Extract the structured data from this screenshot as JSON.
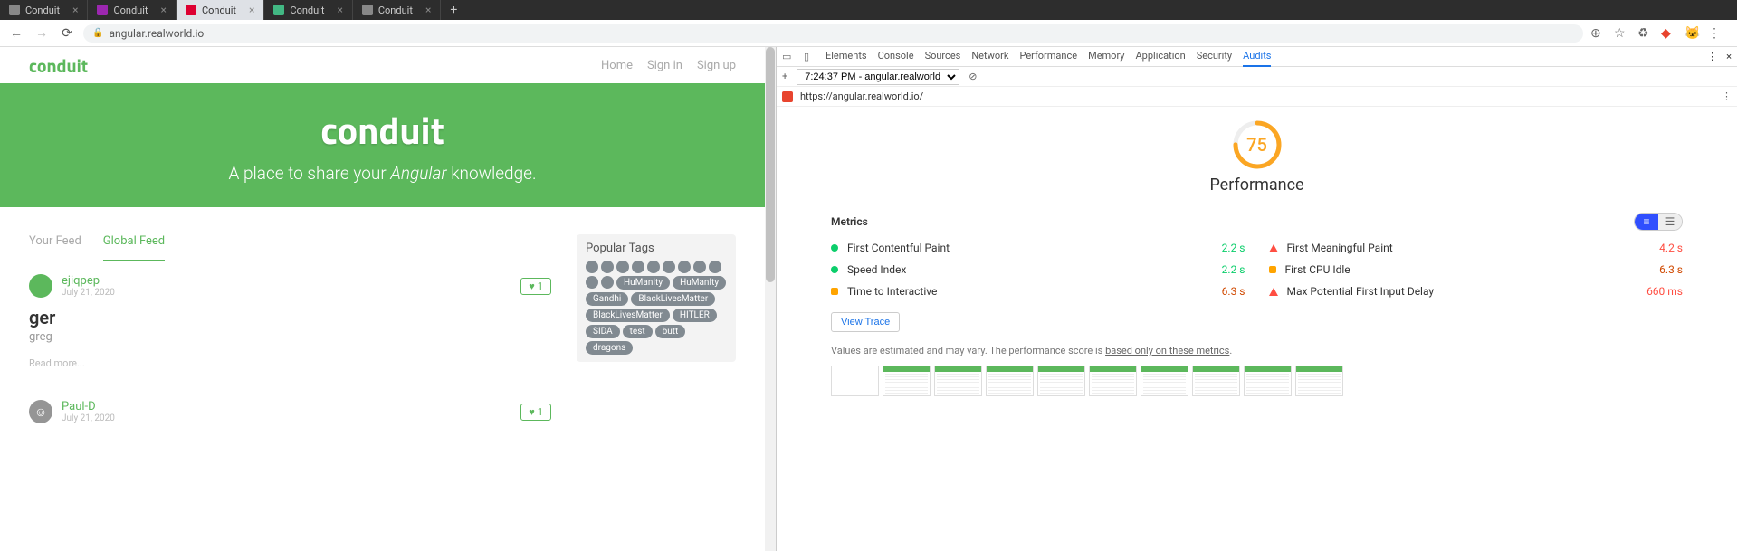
{
  "browser": {
    "tabs": [
      {
        "label": "Conduit",
        "favicon": "#888"
      },
      {
        "label": "Conduit",
        "favicon": "#9c27b0"
      },
      {
        "label": "Conduit",
        "favicon": "#dd0031",
        "active": true
      },
      {
        "label": "Conduit",
        "favicon": "#42b883"
      },
      {
        "label": "Conduit",
        "favicon": "#888"
      }
    ],
    "url": "angular.realworld.io"
  },
  "app": {
    "brand": "conduit",
    "nav": {
      "home": "Home",
      "signin": "Sign in",
      "signup": "Sign up"
    },
    "hero": {
      "title": "conduit",
      "subtitle_pre": "A place to share your ",
      "subtitle_em": "Angular",
      "subtitle_post": " knowledge."
    },
    "feed_tabs": {
      "your": "Your Feed",
      "global": "Global Feed"
    },
    "articles": [
      {
        "author": "ejiqpep",
        "date": "July 21, 2020",
        "likes": "1",
        "title": "ger",
        "desc": "greg",
        "read_more": "Read more...",
        "avatar": "green"
      },
      {
        "author": "Paul-D",
        "date": "July 21, 2020",
        "likes": "1",
        "title": "",
        "desc": "",
        "read_more": "",
        "avatar": "grey"
      }
    ],
    "sidebar": {
      "title": "Popular Tags",
      "empty_tags": 11,
      "tags": [
        "HuManIty",
        "HuManIty",
        "Gandhi",
        "BlackLivesMatter",
        "BlackLivesMatter",
        "HITLER",
        "SIDA",
        "test",
        "butt",
        "dragons"
      ]
    }
  },
  "devtools": {
    "tabs": [
      "Elements",
      "Console",
      "Sources",
      "Network",
      "Performance",
      "Memory",
      "Application",
      "Security",
      "Audits"
    ],
    "active_tab": "Audits",
    "subbar": {
      "plus": "+",
      "dropdown": "7:24:37 PM - angular.realworld",
      "clear": "⊘"
    },
    "url": "https://angular.realworld.io/",
    "score": "75",
    "score_label": "Performance",
    "metrics_title": "Metrics",
    "metrics": [
      {
        "name": "First Contentful Paint",
        "value": "2.2 s",
        "status": "green"
      },
      {
        "name": "First Meaningful Paint",
        "value": "4.2 s",
        "status": "red"
      },
      {
        "name": "Speed Index",
        "value": "2.2 s",
        "status": "green"
      },
      {
        "name": "First CPU Idle",
        "value": "6.3 s",
        "status": "orange"
      },
      {
        "name": "Time to Interactive",
        "value": "6.3 s",
        "status": "orange"
      },
      {
        "name": "Max Potential First Input Delay",
        "value": "660 ms",
        "status": "red"
      }
    ],
    "view_trace": "View Trace",
    "disclaimer_pre": "Values are estimated and may vary. The performance score is ",
    "disclaimer_link": "based only on these metrics",
    "filmstrip": [
      false,
      true,
      true,
      true,
      true,
      true,
      true,
      true,
      true,
      true
    ]
  },
  "chart_data": {
    "type": "gauge",
    "title": "Performance",
    "value": 75,
    "range": [
      0,
      100
    ],
    "color": "#fba623"
  }
}
